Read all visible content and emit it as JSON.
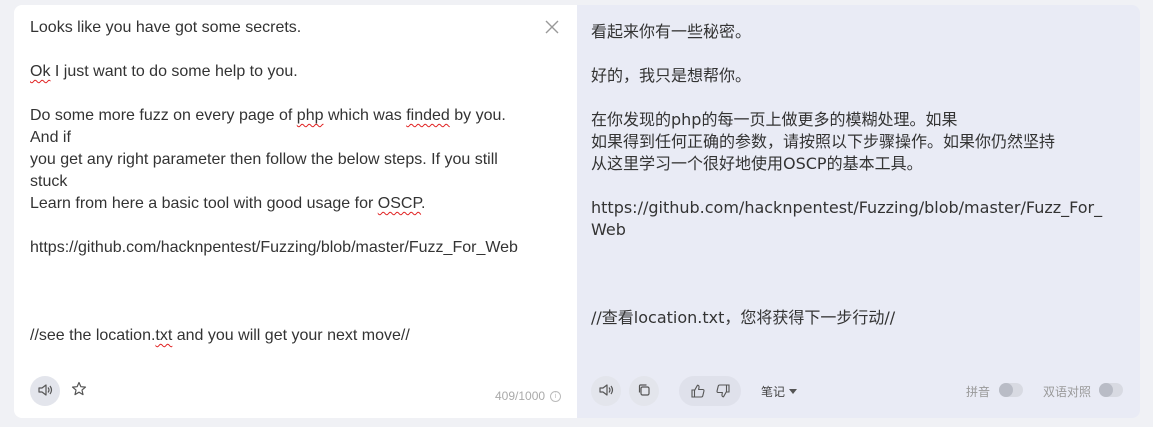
{
  "source": {
    "lines": [
      [
        {
          "t": "Looks like you have got some secrets."
        }
      ],
      [],
      [
        {
          "t": "Ok",
          "wavy": true
        },
        {
          "t": " I just want to do some help to you."
        }
      ],
      [],
      [
        {
          "t": "Do some more fuzz on every page of "
        },
        {
          "t": "php",
          "wavy": true
        },
        {
          "t": " which was "
        },
        {
          "t": "finded",
          "wavy": true
        },
        {
          "t": " by you. And if"
        }
      ],
      [
        {
          "t": "you get any right parameter then follow the below steps. If you still stuck"
        }
      ],
      [
        {
          "t": "Learn from here a basic tool with good usage for "
        },
        {
          "t": "OSCP",
          "wavy": true
        },
        {
          "t": "."
        }
      ],
      [],
      [
        {
          "t": "https://github.com/hacknpentest/Fuzzing/blob/master/Fuzz_For_Web"
        }
      ],
      [],
      [],
      [],
      [
        {
          "t": "//see the location."
        },
        {
          "t": "txt",
          "wavy": true
        },
        {
          "t": " and you will get your next move//"
        }
      ]
    ],
    "char_count": "409/1000",
    "close_icon": "close-icon",
    "speaker_icon": "speaker-icon",
    "star_icon": "star-icon"
  },
  "translation": {
    "lines": [
      "看起来你有一些秘密。",
      "",
      "好的，我只是想帮你。",
      "",
      "在你发现的php的每一页上做更多的模糊处理。如果",
      "如果得到任何正确的参数，请按照以下步骤操作。如果你仍然坚持",
      "从这里学习一个很好地使用OSCP的基本工具。",
      "",
      "https://github.com/hacknpentest/Fuzzing/blob/master/Fuzz_For_Web",
      "",
      "",
      "",
      "//查看location.txt，您将获得下一步行动//"
    ],
    "notes_label": "笔记",
    "pinyin_label": "拼音",
    "bilingual_label": "双语对照",
    "pinyin_on": false,
    "bilingual_on": false
  },
  "colors": {
    "left_bg": "#ffffff",
    "right_bg": "#e9ebf5",
    "page_bg": "#f0f1f5",
    "spell_error": "#e02020"
  }
}
